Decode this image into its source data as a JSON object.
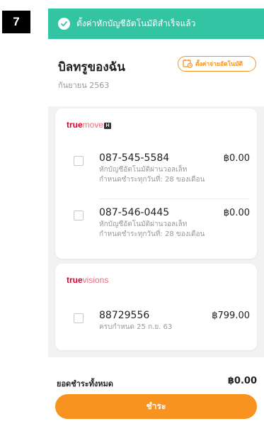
{
  "step_badge": "7",
  "toast": {
    "text": "ตั้งค่าหักบัญชีอัตโนมัติสำเร็จแล้ว",
    "icon": "check-circle-icon"
  },
  "header": {
    "title": "บิลทรูของฉัน",
    "subtitle": "กันยายน 2563",
    "autopay_button": "ตั้งค่าจ่ายอัตโนมัติ"
  },
  "truemove": {
    "brand": {
      "part1": "true",
      "part2": "move",
      "part3": "H"
    },
    "items": [
      {
        "number": "087-545-5584",
        "amount": "฿0.00",
        "desc1": "หักบัญชีอัตโนมัติผ่านวอลเล็ท",
        "desc2": "กำหนดชำระทุกวันที่: 28 ของเดือน"
      },
      {
        "number": "087-546-0445",
        "amount": "฿0.00",
        "desc1": "หักบัญชีอัตโนมัติผ่านวอลเล็ท",
        "desc2": "กำหนดชำระทุกวันที่: 28 ของเดือน"
      }
    ]
  },
  "truevisions": {
    "brand": {
      "part1": "true",
      "part2": "visions"
    },
    "items": [
      {
        "number": "88729556",
        "amount": "฿799.00",
        "desc1": "ครบกำหนด 25 ก.ย. 63"
      }
    ]
  },
  "footer": {
    "total_label": "ยอดชำระทั้งหมด",
    "total_value": "฿0.00",
    "pay_button": "ชำระ"
  },
  "colors": {
    "accent": "#f7931e",
    "toast": "#33c4a4",
    "brand_red": "#e4002b"
  }
}
